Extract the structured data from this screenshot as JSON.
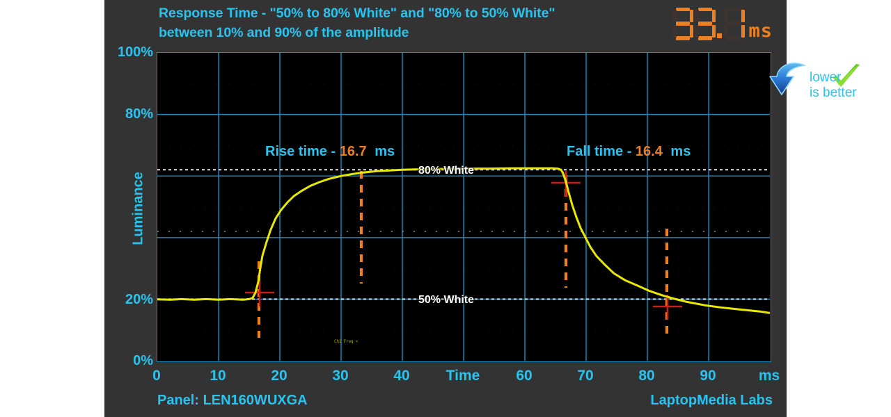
{
  "card": {
    "title_line1": "Response Time - \"50% to 80% White\" and \"80% to 50% White\"",
    "title_line2": "between 10% and 90% of the amplitude",
    "panel_label": "Panel: LEN160WUXGA",
    "lab_label": "LaptopMedia Labs"
  },
  "readout": {
    "value": "33.1",
    "digits": [
      "3",
      "3",
      "1"
    ],
    "unit": "ms",
    "color": "#ef8022",
    "off_color": "#3d3431"
  },
  "badge": {
    "line1": "lower",
    "line2": "is better",
    "arrow_icon": "curved-down-arrow-icon",
    "check_icon": "check-mark-icon",
    "arrow_color": "#1f6fd0",
    "check_color": "#66cc22"
  },
  "annotations": {
    "rise_label": "Rise time -",
    "rise_value": "16.7",
    "rise_unit": "ms",
    "fall_label": "Fall time -",
    "fall_value": "16.4",
    "fall_unit": "ms",
    "high_ref": "80% White",
    "low_ref": "50% White",
    "scope_note": "Ch1 Freq <"
  },
  "chart_data": {
    "type": "line",
    "title": "Response Time - \"50% to 80% White\" and \"80% to 50% White\" between 10% and 90% of the amplitude",
    "xlabel": "Time",
    "ylabel": "Luminance",
    "x_unit": "ms",
    "xlim": [
      0,
      100
    ],
    "ylim": [
      0,
      100
    ],
    "xticks": [
      0,
      10,
      20,
      30,
      40,
      50,
      60,
      70,
      80,
      90,
      100
    ],
    "xtick_labels": [
      "0",
      "10",
      "20",
      "30",
      "40",
      "Time",
      "60",
      "70",
      "80",
      "90",
      "ms"
    ],
    "yticks": [
      0,
      20,
      40,
      60,
      80,
      100
    ],
    "ytick_labels": [
      "0%",
      "20%",
      "",
      "",
      "80%",
      "100%"
    ],
    "grid": true,
    "grid_color": "#1b8fc4",
    "background": "#000000",
    "trace_color": "#e8e800",
    "marker_color": "#ef8022",
    "crosshair_color": "#c8201a",
    "reference_lines": [
      {
        "name": "80% White",
        "y": 62.0,
        "style": "dotted",
        "color": "#dddddd"
      },
      {
        "name": "mid",
        "y": 42.0,
        "style": "dotted",
        "color": "#9a9a9a"
      },
      {
        "name": "50% White",
        "y": 20.0,
        "style": "dotted",
        "color": "#dddddd"
      }
    ],
    "markers": [
      {
        "name": "rise-10pct",
        "x": 16.6,
        "y_cross": 24.2,
        "type": "dashed-vline+crosshair"
      },
      {
        "name": "rise-90pct",
        "x": 33.3,
        "y_cross": 58.0,
        "type": "dashed-vline+crosshair"
      },
      {
        "name": "fall-90pct",
        "x": 66.7,
        "y_cross": 58.0,
        "type": "dashed-vline+crosshair"
      },
      {
        "name": "fall-10pct",
        "x": 83.1,
        "y_cross": 24.2,
        "type": "dashed-vline+crosshair"
      }
    ],
    "series": [
      {
        "name": "Luminance response",
        "color": "#e8e800",
        "x": [
          0,
          2,
          4,
          6,
          8,
          10,
          12,
          14,
          15,
          15.6,
          16.0,
          16.4,
          16.8,
          17.2,
          17.8,
          18.5,
          19.3,
          20.2,
          21.2,
          22.3,
          23.5,
          25,
          26.5,
          28,
          30,
          32,
          34,
          36,
          38,
          40,
          43,
          46,
          50,
          54,
          58,
          62,
          64.5,
          65.4,
          65.9,
          66.2,
          66.6,
          67.0,
          67.5,
          68.1,
          68.8,
          69.6,
          70.6,
          71.8,
          73.2,
          75,
          77,
          79,
          81,
          83,
          85,
          88,
          91,
          94,
          97,
          100
        ],
        "y": [
          19.9,
          19.8,
          19.9,
          19.8,
          19.9,
          19.8,
          19.9,
          19.8,
          19.9,
          20.3,
          22.0,
          25.5,
          30.0,
          34.0,
          38.5,
          42.5,
          46.0,
          48.8,
          51.2,
          53.2,
          54.9,
          56.6,
          57.8,
          58.8,
          59.8,
          60.5,
          61.0,
          61.4,
          61.6,
          61.8,
          62.0,
          62.1,
          62.2,
          62.2,
          62.3,
          62.3,
          62.3,
          62.2,
          61.8,
          60.6,
          58.0,
          54.5,
          50.5,
          46.5,
          43.0,
          39.8,
          36.8,
          34.0,
          31.2,
          29.0,
          27.2,
          25.8,
          24.6,
          23.6,
          22.5,
          21.7,
          21.1,
          20.5,
          20.0
        ]
      }
    ]
  }
}
